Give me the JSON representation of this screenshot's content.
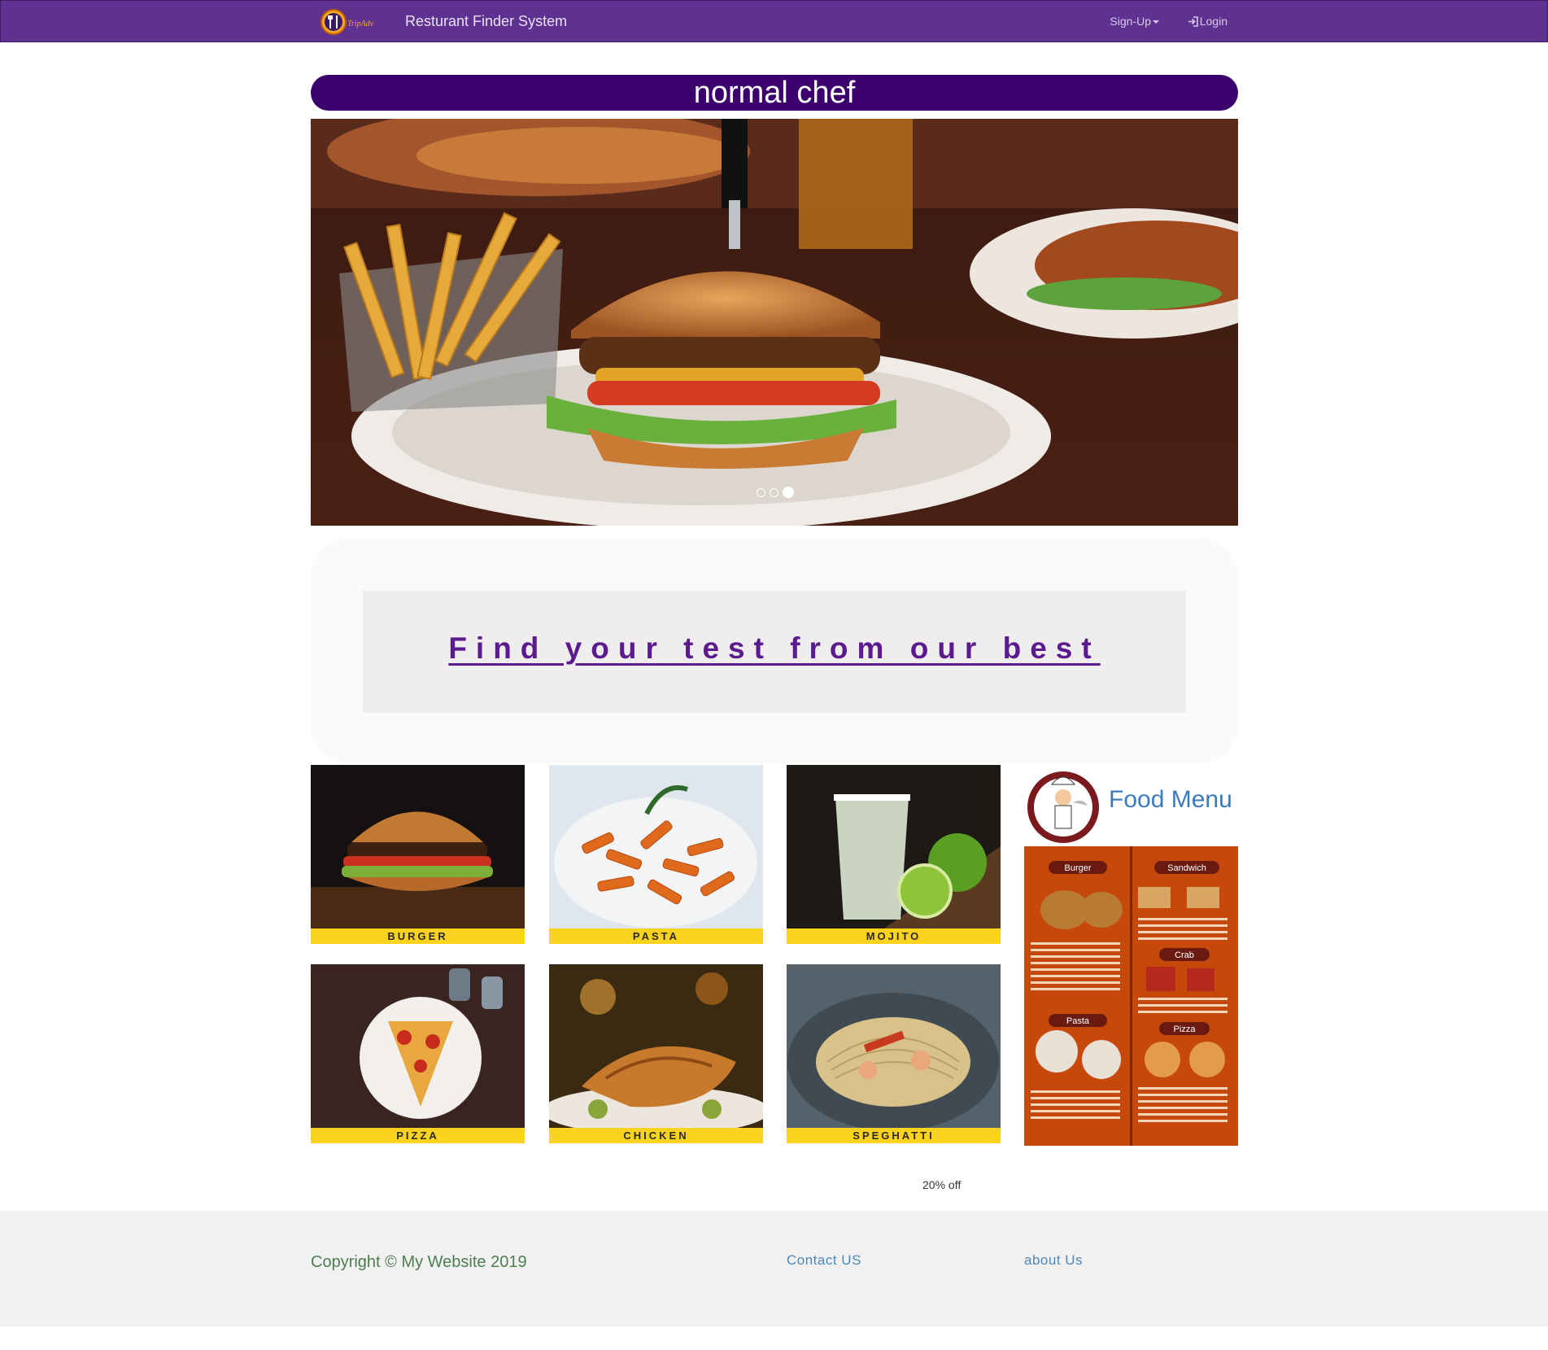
{
  "navbar": {
    "brand": "Resturant Finder System",
    "logo_text": "TripAdvisor",
    "signup_label": "Sign-Up",
    "login_label": "Login"
  },
  "page_title": "normal chef",
  "carousel": {
    "active_index": 2,
    "slide_count": 3
  },
  "tagline": "Find your test from our best",
  "foods": [
    {
      "label": "BURGER"
    },
    {
      "label": "PASTA"
    },
    {
      "label": "MOJITO"
    },
    {
      "label": "PIZZA"
    },
    {
      "label": "CHICKEN"
    },
    {
      "label": "SPEGHATTI"
    }
  ],
  "menu": {
    "title": "Food Menu",
    "sections": [
      "Burger",
      "Sandwich",
      "Crab",
      "Pasta",
      "Pizza"
    ]
  },
  "discount": "20% off",
  "footer": {
    "copyright": "Copyright © My Website 2019",
    "contact": "Contact US",
    "about": "about Us"
  },
  "colors": {
    "navbar": "#5f3190",
    "title_bar": "#3c006e",
    "label_bar": "#fbd21d",
    "tagline": "#5b1a8e"
  }
}
